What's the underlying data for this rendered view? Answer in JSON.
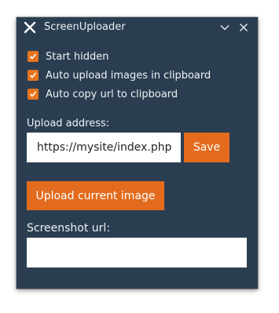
{
  "window": {
    "title": "ScreenUploader"
  },
  "titlebar": {
    "icon": "x-logo-icon",
    "minimize_icon": "chevron-down-icon",
    "close_icon": "close-icon"
  },
  "options": [
    {
      "label": "Start hidden",
      "checked": true
    },
    {
      "label": "Auto upload images in clipboard",
      "checked": true
    },
    {
      "label": "Auto copy url to clipboard",
      "checked": true
    }
  ],
  "upload": {
    "address_label": "Upload address:",
    "address_value": "https://mysite/index.php",
    "save_label": "Save",
    "upload_button_label": "Upload current image"
  },
  "screenshot": {
    "url_label": "Screenshot url:",
    "url_value": ""
  },
  "colors": {
    "window_bg": "#2b3e51",
    "accent": "#e26b1d",
    "text": "#eef2f5"
  }
}
